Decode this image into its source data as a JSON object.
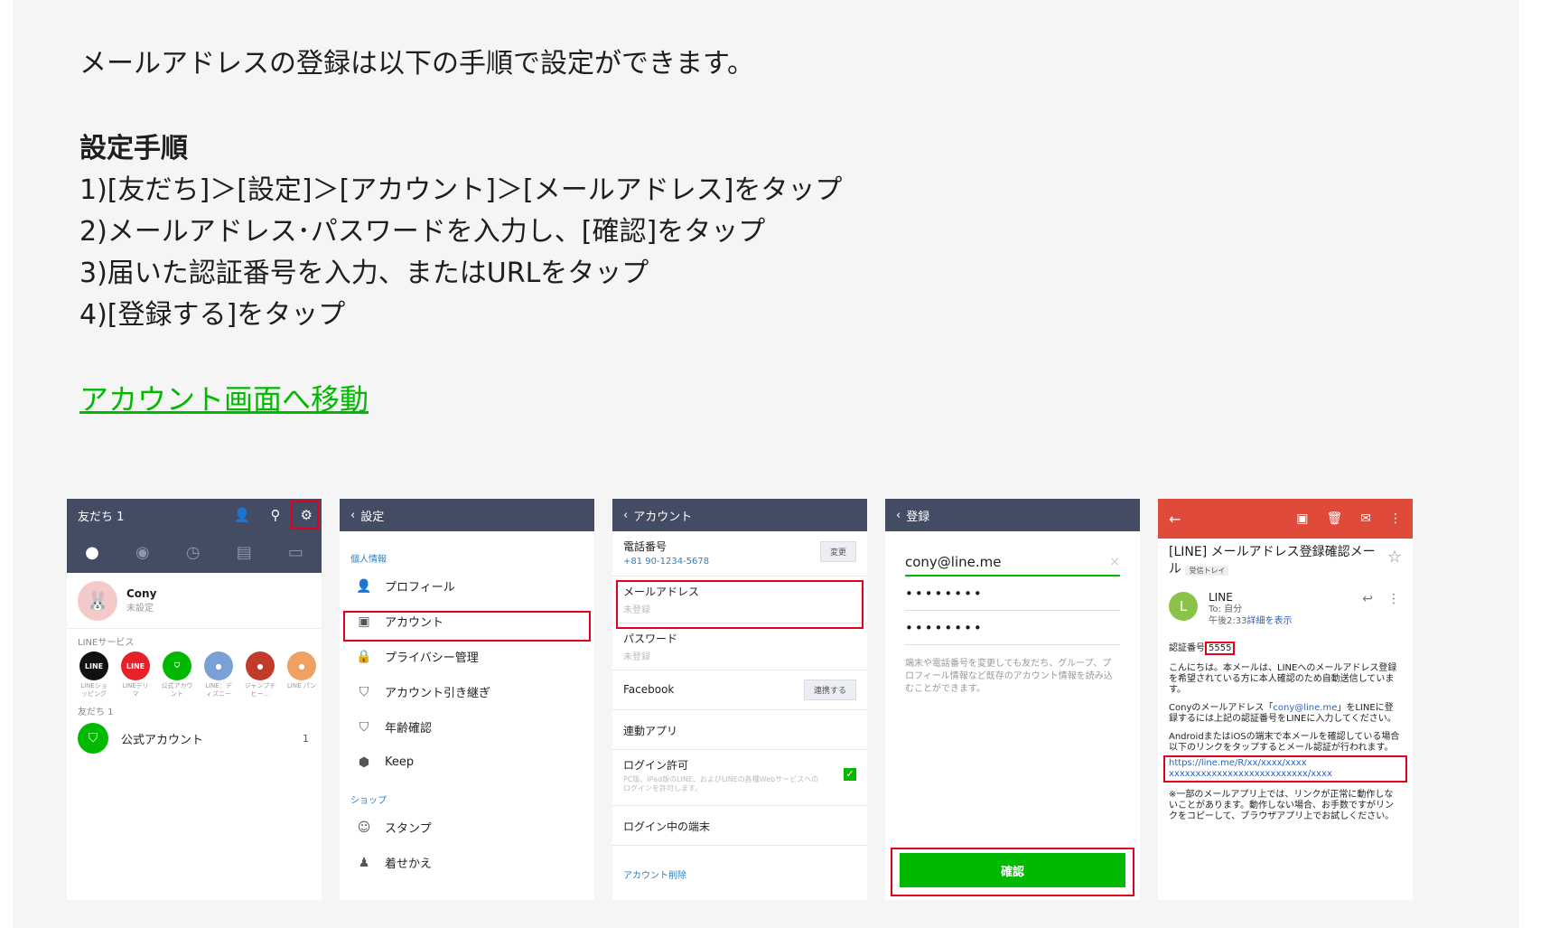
{
  "intro": "メールアドレスの登録は以下の手順で設定ができます。",
  "steps_title": "設定手順",
  "steps": [
    "1)[友だち]＞[設定]＞[アカウント]＞[メールアドレス]をタップ",
    "2)メールアドレス･パスワードを入力し、[確認]をタップ",
    "3)届いた認証番号を入力、またはURLをタップ",
    "4)[登録する]をタップ"
  ],
  "link_text": "アカウント画面へ移動",
  "colors": {
    "line_green": "#00b900",
    "header_navy": "#444c63",
    "highlight_red": "#e3001b",
    "gmail_red": "#e04a3a"
  },
  "screen1": {
    "title": "友だち 1",
    "profile_name": "Cony",
    "profile_status": "未設定",
    "services_label": "LINEサービス",
    "services": [
      {
        "badge": "LINE",
        "label": "LINEショッピング",
        "color": "#111111"
      },
      {
        "badge": "LINE",
        "label": "LINEデリマ",
        "color": "#e8202a"
      },
      {
        "badge": "⛉",
        "label": "公式アカウント",
        "color": "#00b900"
      },
      {
        "badge": "●",
        "label": "LINE：ディズニー",
        "color": "#7aa0d8"
      },
      {
        "badge": "●",
        "label": "ジャンプチヒー…",
        "color": "#c23b2a"
      },
      {
        "badge": "●",
        "label": "LINE パン",
        "color": "#f0a060"
      }
    ],
    "friends_label": "友だち 1",
    "friend_name": "公式アカウント",
    "friend_count": "1"
  },
  "screen2": {
    "title": "設定",
    "section1": "個人情報",
    "items1": [
      "プロフィール",
      "アカウント",
      "プライバシー管理",
      "アカウント引き継ぎ",
      "年齢確認",
      "Keep"
    ],
    "icons1": [
      "person-icon",
      "id-card-icon",
      "lock-icon",
      "shield-icon",
      "shield-icon",
      "keep-icon"
    ],
    "section2": "ショップ",
    "items2": [
      "スタンプ",
      "着せかえ"
    ]
  },
  "screen3": {
    "title": "アカウント",
    "phone_label": "電話番号",
    "phone_value": "+81 90-1234-5678",
    "change_btn": "変更",
    "email_label": "メールアドレス",
    "email_value": "未登録",
    "password_label": "パスワード",
    "password_value": "未登録",
    "facebook_label": "Facebook",
    "facebook_btn": "連携する",
    "apps_label": "連動アプリ",
    "login_allow_label": "ログイン許可",
    "login_allow_desc": "PC版、iPad版のLINE、およびLINEの各種Webサービスへのログインを許可します。",
    "devices_label": "ログイン中の端末",
    "delete_label": "アカウント削除"
  },
  "screen4": {
    "title": "登録",
    "email_value": "cony@line.me",
    "password1": "••••••••",
    "password2": "••••••••",
    "note": "端末や電話番号を変更しても友だち、グループ、プロフィール情報など既存のアカウント情報を読み込むことができます。",
    "confirm_btn": "確認"
  },
  "screen5": {
    "subject": "[LINE] メールアドレス登録確認メール",
    "label": "受信トレイ",
    "sender": "LINE",
    "to": "To: 自分",
    "time": "午後2:33",
    "details": "詳細を表示",
    "code_label": "認証番号",
    "code_value": "5555",
    "para1": "こんにちは。本メールは、LINEへのメールアドレス登録を希望されている方に本人確認のため自動送信しています。",
    "para2_a": "Conyのメールアドレス「",
    "para2_link": "cony@line.me",
    "para2_b": "」をLINEに登録するには上記の認証番号をLINEに入力してください。",
    "para3": "AndroidまたはiOSの端末で本メールを確認している場合以下のリンクをタップするとメール認証が行われます。",
    "url_line1": "https://line.me/R/xx/xxxx/xxxx",
    "url_line2": "xxxxxxxxxxxxxxxxxxxxxxxxxx/xxxx",
    "para4": "※一部のメールアプリ上では、リンクが正常に動作しないことがあります。動作しない場合、お手数ですがリンクをコピーして、ブラウザアプリ上でお試しください。"
  }
}
